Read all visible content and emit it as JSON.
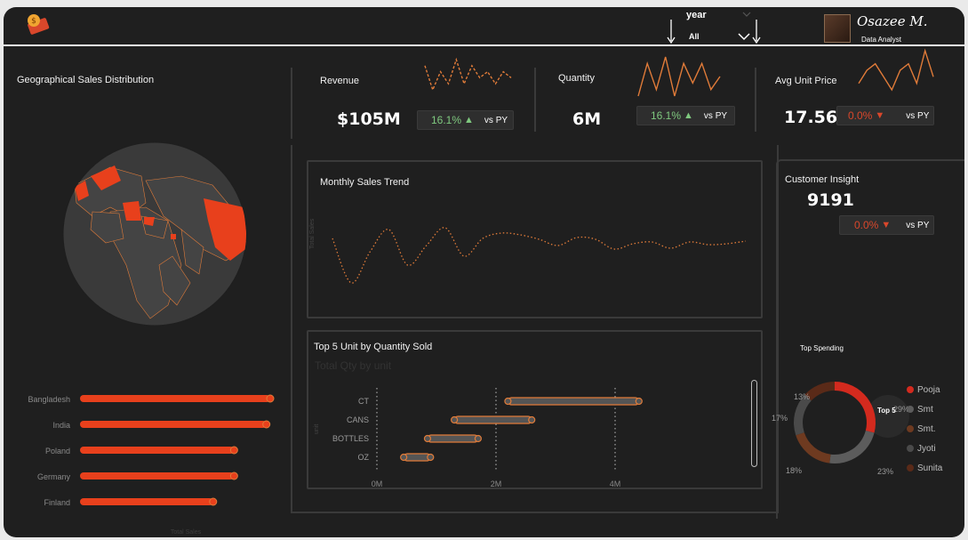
{
  "header": {
    "filter_label": "year",
    "filter_value": "All",
    "author_name": "Osazee M.",
    "author_role": "Data Analyst"
  },
  "geo": {
    "title": "Geographical Sales Distribution",
    "axis_label": "Total Sales"
  },
  "kpis": {
    "revenue": {
      "label": "Revenue",
      "value": "$105M",
      "delta": "16.1%",
      "vs": "vs PY"
    },
    "quantity": {
      "label": "Quantity",
      "value": "6M",
      "delta": "16.1%",
      "vs": "vs PY"
    },
    "avg_price": {
      "label": "Avg Unit Price",
      "value": "17.56",
      "delta": "0.0%",
      "vs": "vs PY"
    }
  },
  "trend": {
    "title": "Monthly Sales Trend",
    "axis_label": "Total Sales"
  },
  "top5": {
    "title": "Top 5 Unit by Quantity Sold",
    "subtitle": "Total Qty by unit",
    "axis_label": "unit"
  },
  "customer": {
    "title": "Customer Insight",
    "value": "9191",
    "delta": "0.0%",
    "vs": "vs PY"
  },
  "spending": {
    "title": "Top Spending",
    "center_label": "Top 5"
  },
  "colors": {
    "accent": "#e8401c",
    "orange": "#e07b39",
    "green": "#7fc97f",
    "red": "#d9472b",
    "panel": "#1f1f1f"
  },
  "chart_data": [
    {
      "type": "bar",
      "orientation": "horizontal",
      "categories": [
        "Bangladesh",
        "India",
        "Poland",
        "Germany",
        "Finland"
      ],
      "values": [
        100,
        98,
        81,
        81,
        70
      ],
      "xlabel": "Total Sales"
    },
    {
      "type": "line",
      "title": "Revenue sparkline",
      "values": [
        7,
        3,
        6,
        4,
        8,
        4,
        7,
        5,
        6,
        4,
        6,
        5
      ]
    },
    {
      "type": "line",
      "title": "Quantity sparkline",
      "values": [
        3,
        8,
        4,
        9,
        3,
        8,
        5,
        8,
        4,
        6
      ]
    },
    {
      "type": "line",
      "title": "Avg Unit Price sparkline",
      "values": [
        4,
        6,
        7,
        5,
        3,
        6,
        7,
        4,
        9,
        5
      ]
    },
    {
      "type": "line",
      "title": "Monthly Sales Trend",
      "ylabel": "Total Sales",
      "values": [
        70,
        20,
        55,
        80,
        40,
        62,
        82,
        50,
        70,
        76,
        74,
        69,
        62,
        71,
        69,
        58,
        64,
        66,
        59,
        66,
        63,
        64,
        67
      ]
    },
    {
      "type": "bar",
      "orientation": "horizontal-range",
      "title": "Top 5 Unit by Quantity Sold",
      "categories": [
        "CT",
        "CANS",
        "BOTTLES",
        "OZ"
      ],
      "ranges": [
        [
          2.2,
          4.4
        ],
        [
          1.3,
          2.6
        ],
        [
          0.85,
          1.7
        ],
        [
          0.45,
          0.9
        ]
      ],
      "x_ticks": [
        "0M",
        "2M",
        "4M"
      ],
      "xlim": [
        0,
        5
      ]
    },
    {
      "type": "pie",
      "title": "Top Spending",
      "series": [
        {
          "name": "Pooja",
          "value": 29,
          "label": "29%",
          "color": "#d32a1e"
        },
        {
          "name": "Smt",
          "value": 23,
          "label": "23%",
          "color": "#5c5c5c"
        },
        {
          "name": "Smt.",
          "value": 18,
          "label": "18%",
          "color": "#6e3a20"
        },
        {
          "name": "Jyoti",
          "value": 17,
          "label": "17%",
          "color": "#4a4a4a"
        },
        {
          "name": "Sunita",
          "value": 13,
          "label": "13%",
          "color": "#5a2a18"
        }
      ]
    }
  ]
}
